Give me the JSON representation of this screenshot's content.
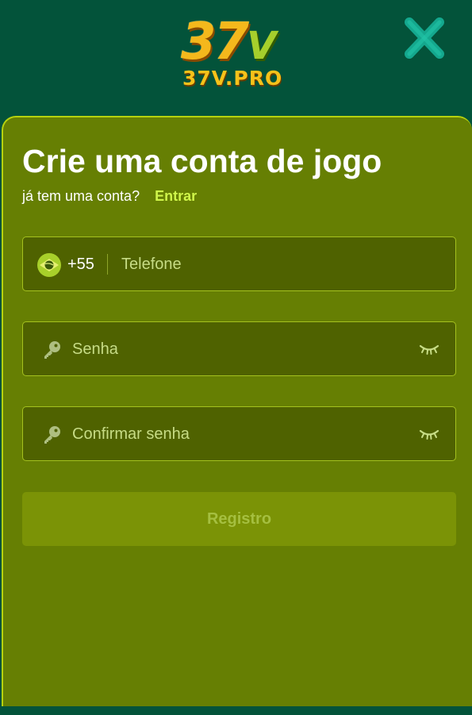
{
  "header": {
    "logo_mark": "37",
    "logo_mark_v": "V",
    "logo_domain": "37V.PRO",
    "close_icon": "close-x-icon"
  },
  "form": {
    "title": "Crie uma conta de jogo",
    "login_prompt": "já tem uma conta?",
    "login_link": "Entrar",
    "phone": {
      "flag_icon": "brazil-flag-icon",
      "country_code": "+55",
      "placeholder": "Telefone"
    },
    "password": {
      "icon": "key-icon",
      "placeholder": "Senha",
      "toggle_icon": "eye-closed-icon"
    },
    "confirm_password": {
      "icon": "key-icon",
      "placeholder": "Confirmar senha",
      "toggle_icon": "eye-closed-icon"
    },
    "submit_label": "Registro"
  },
  "colors": {
    "header_bg": "#03533a",
    "card_bg": "#667f03",
    "accent": "#cff54a",
    "field_bg": "#4f6200"
  }
}
